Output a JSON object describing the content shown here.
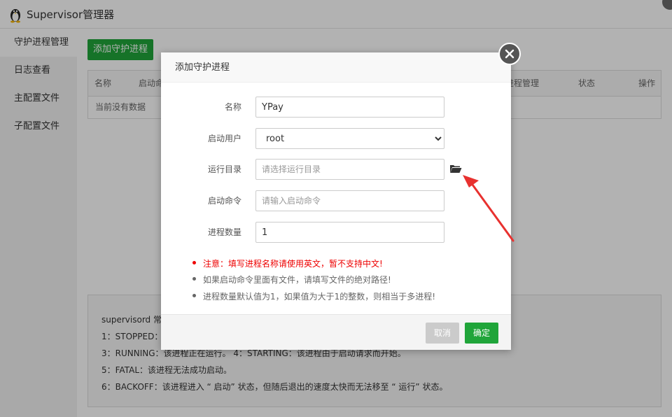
{
  "window": {
    "title": "Supervisor管理器"
  },
  "sidebar": {
    "items": [
      {
        "label": "守护进程管理"
      },
      {
        "label": "日志查看"
      },
      {
        "label": "主配置文件"
      },
      {
        "label": "子配置文件"
      }
    ]
  },
  "main": {
    "add_button": "添加守护进程",
    "table": {
      "headers": [
        "名称",
        "启动命",
        "进程管理",
        "状态",
        "操作"
      ],
      "empty_text": "当前没有数据"
    },
    "info": {
      "lines": [
        "supervisord 常",
        "1：STOPPED：",
        "3：RUNNING：该进程正在运行。 4：STARTING：该进程由于启动请求而开始。",
        "5：FATAL：该进程无法成功启动。",
        "6：BACKOFF：该进程进入 “ 启动” 状态，但随后退出的速度太快而无法移至 “ 运行” 状态。"
      ]
    }
  },
  "dialog": {
    "title": "添加守护进程",
    "fields": {
      "name": {
        "label": "名称",
        "value": "YPay"
      },
      "user": {
        "label": "启动用户",
        "value": "root"
      },
      "dir": {
        "label": "运行目录",
        "placeholder": "请选择运行目录"
      },
      "cmd": {
        "label": "启动命令",
        "placeholder": "请输入启动命令"
      },
      "count": {
        "label": "进程数量",
        "value": "1"
      }
    },
    "notes": [
      "注意：填写进程名称请使用英文，暂不支持中文!",
      "如果启动命令里面有文件，请填写文件的绝对路径!",
      "进程数量默认值为1，如果值为大于1的整数，则相当于多进程!"
    ],
    "cancel": "取消",
    "ok": "确定"
  },
  "colors": {
    "accent": "#20a53a",
    "warning": "#ee0000",
    "annotation_arrow": "#e8312f"
  },
  "icons": [
    "penguin-logo-icon",
    "close-icon",
    "folder-open-icon"
  ]
}
